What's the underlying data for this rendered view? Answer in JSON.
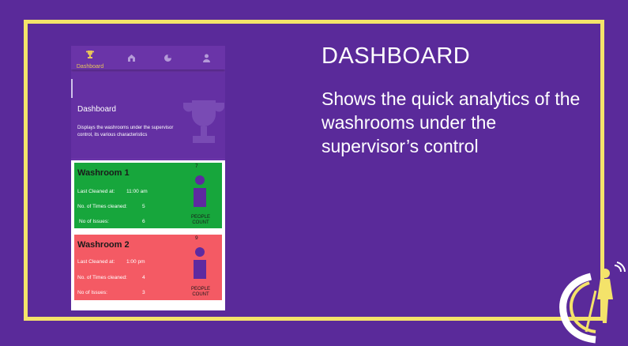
{
  "nav": {
    "dashboard_label": "Dashboard"
  },
  "hero": {
    "title": "Dashboard",
    "description": "Displays the washrooms under the supervisor control, its various characteristics"
  },
  "washrooms": [
    {
      "name": "Washroom 1",
      "last_cleaned_label": "Last Cleaned at:",
      "last_cleaned_value": "11:00 am",
      "times_cleaned_label": "No. of Times cleaned:",
      "times_cleaned_value": "5",
      "issues_label": "No of Issues:",
      "issues_value": "6",
      "people_count": "7",
      "people_label": "PEOPLE COUNT",
      "status_color": "#17a63c"
    },
    {
      "name": "Washroom 2",
      "last_cleaned_label": "Last Cleaned at:",
      "last_cleaned_value": "1:00 pm",
      "times_cleaned_label": "No. of Times cleaned:",
      "times_cleaned_value": "4",
      "issues_label": "No of Issues:",
      "issues_value": "3",
      "people_count": "9",
      "people_label": "PEOPLE COUNT",
      "status_color": "#f45a64"
    }
  ],
  "slide": {
    "heading": "DASHBOARD",
    "description": "Shows the quick analytics of the washrooms under the supervisor’s control"
  },
  "icons": [
    "trophy-icon",
    "home-icon",
    "pie-chart-icon",
    "user-icon",
    "person-icon",
    "janitor-logo"
  ]
}
